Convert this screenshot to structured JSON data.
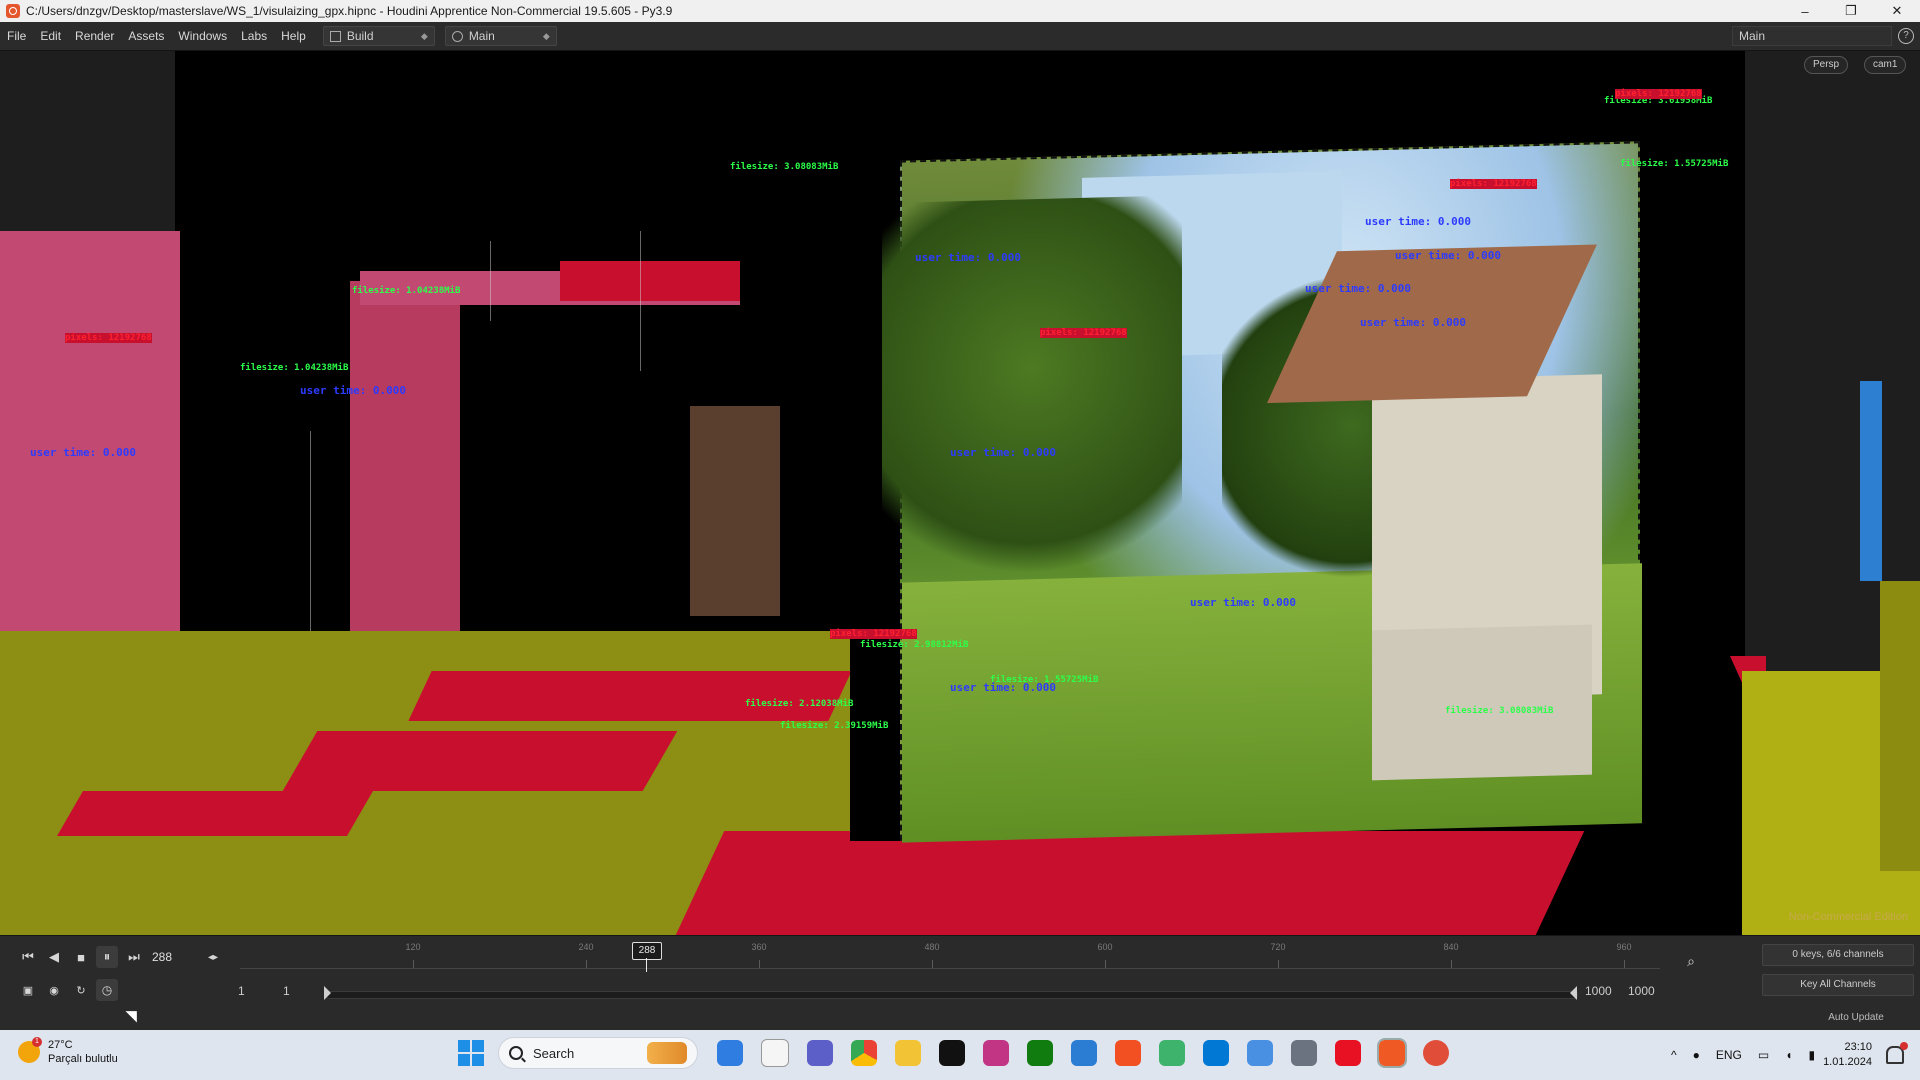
{
  "window": {
    "title": "C:/Users/dnzgv/Desktop/masterslave/WS_1/visulaizing_gpx.hipnc - Houdini Apprentice Non-Commercial 19.5.605 - Py3.9",
    "minimize": "–",
    "maximize": "❐",
    "close": "✕"
  },
  "menubar": {
    "items": [
      "File",
      "Edit",
      "Render",
      "Assets",
      "Windows",
      "Labs",
      "Help"
    ],
    "desktop_select": "Build",
    "context_select": "Main",
    "right_desktop": "Main",
    "help": "?"
  },
  "viewport": {
    "camera_view": "Persp",
    "camera_name": "cam1",
    "watermark": "Non-Commercial Edition",
    "overlays": {
      "user_time": "user time: 0.000",
      "filesize": "filesize: 1.04238MiB",
      "filesize_b": "filesize: 3.61958MiB",
      "filesize_c": "filesize: 2.98812MiB",
      "filesize_d": "filesize: 3.08083MiB",
      "filesize_e": "filesize: 1.55725MiB",
      "filesize_f": "filesize: 2.12038MiB",
      "filesize_g": "filesize: 2.39159MiB",
      "pixels": "pixels: 12192768"
    }
  },
  "playbar": {
    "current_frame": "288",
    "cursor_frame": "288",
    "ticks": [
      "120",
      "240",
      "360",
      "480",
      "600",
      "720",
      "840",
      "960"
    ],
    "range_start": "1",
    "range_start2": "1",
    "range_end": "1000",
    "range_end2": "1000",
    "keys_info": "0 keys, 6/6 channels",
    "key_all": "Key All Channels",
    "auto_update": "Auto Update",
    "icons": {
      "first": "⏮",
      "prev": "◀",
      "stop": "■",
      "pause": "⏸",
      "last": "⏭"
    }
  },
  "taskbar": {
    "weather_temp": "27°C",
    "weather_desc": "Parçalı bulutlu",
    "weather_badge": "1",
    "search_placeholder": "Search",
    "language": "ENG",
    "time": "23:10",
    "date": "1.01.2024",
    "app_colors": [
      "#2f7de1",
      "#f59e0b",
      "#5b5fc7",
      "#ea4335",
      "#f2c335",
      "#111111",
      "#c13584",
      "#107c10",
      "#2b7cd3",
      "#f25022",
      "#3db36b",
      "#0078d4",
      "#4a90e2",
      "#6b7280",
      "#e81123",
      "#ef5a24",
      "#e04e39"
    ]
  }
}
